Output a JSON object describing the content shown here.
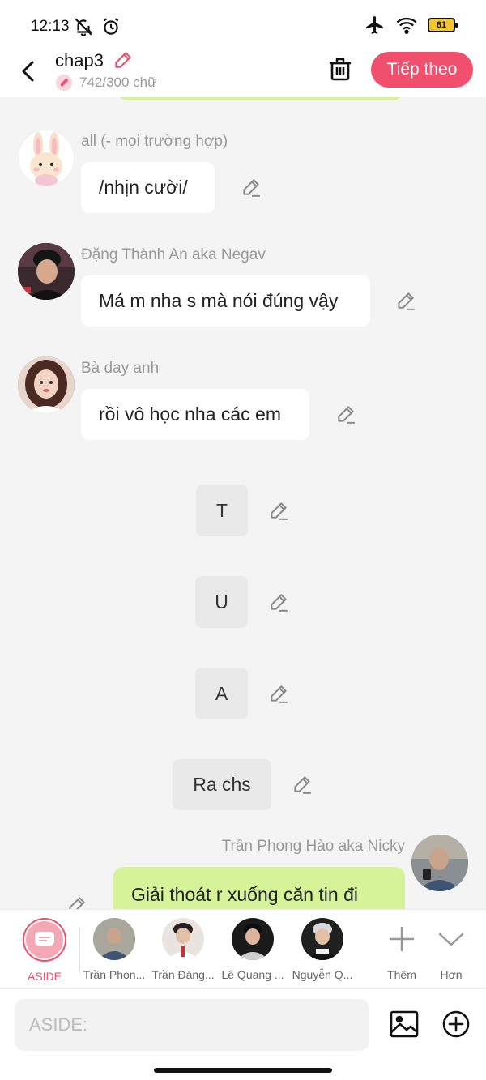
{
  "status_bar": {
    "time": "12:13",
    "battery_level": "81",
    "left_icons": [
      "bell-off-icon",
      "alarm-icon"
    ],
    "right_icons": [
      "airplane-icon",
      "wifi-icon",
      "battery-icon"
    ]
  },
  "header": {
    "title": "chap3",
    "word_count": "742/300 chữ",
    "next_label": "Tiếp theo",
    "accent_color": "#f0506e"
  },
  "messages": [
    {
      "sender": "all (- mọi trường hợp)",
      "text": "/nhịn cười/"
    },
    {
      "sender": "Đặng Thành An aka Negav",
      "text": "Má m nha s mà nói đúng vậy"
    },
    {
      "sender": "Bà dạy anh",
      "text": "rồi vô học nha các em"
    }
  ],
  "narrations": [
    "T",
    "U",
    "A",
    "Ra chs"
  ],
  "outgoing": {
    "sender": "Trần Phong Hào aka Nicky",
    "text": "Giải thoát r xuống căn tin đi",
    "bubble_color": "#d7f39a"
  },
  "characters": {
    "aside_label": "ASIDE",
    "items": [
      {
        "name": "Trần Phon..."
      },
      {
        "name": "Trần Đăng..."
      },
      {
        "name": "Lê Quang ..."
      },
      {
        "name": "Nguyễn Q..."
      }
    ],
    "more_label": "Thêm",
    "expand_label": "Hơn"
  },
  "input": {
    "placeholder": "ASIDE:"
  }
}
